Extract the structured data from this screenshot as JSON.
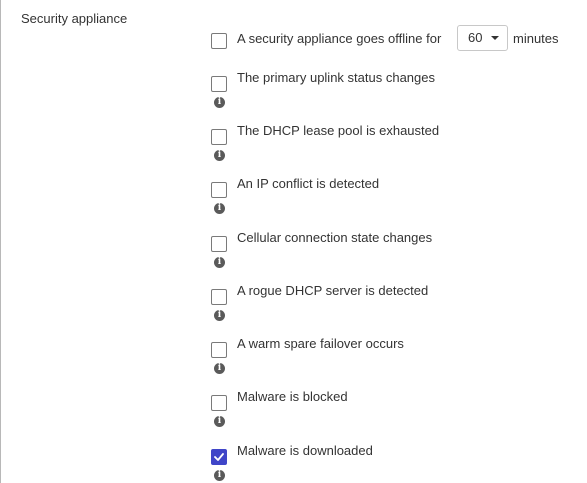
{
  "section": {
    "title": "Security appliance"
  },
  "offline_alert": {
    "label": "A security appliance goes offline for",
    "select_value": "60",
    "suffix": "minutes",
    "checked": false
  },
  "alerts": [
    {
      "label": "The primary uplink status changes",
      "checked": false,
      "icon": "info-icon"
    },
    {
      "label": "The DHCP lease pool is exhausted",
      "checked": false,
      "icon": "info-icon"
    },
    {
      "label": "An IP conflict is detected",
      "checked": false,
      "icon": "info-icon"
    },
    {
      "label": "Cellular connection state changes",
      "checked": false,
      "icon": "info-icon"
    },
    {
      "label": "A rogue DHCP server is detected",
      "checked": false,
      "icon": "info-icon"
    },
    {
      "label": "A warm spare failover occurs",
      "checked": false,
      "icon": "info-icon"
    },
    {
      "label": "Malware is blocked",
      "checked": false,
      "icon": "info-icon"
    },
    {
      "label": "Malware is downloaded",
      "checked": true,
      "icon": "info-icon"
    }
  ],
  "info_glyph": "i",
  "colors": {
    "accent": "#3f45c8",
    "text": "#333333",
    "info_icon": "#5a5a5a"
  }
}
